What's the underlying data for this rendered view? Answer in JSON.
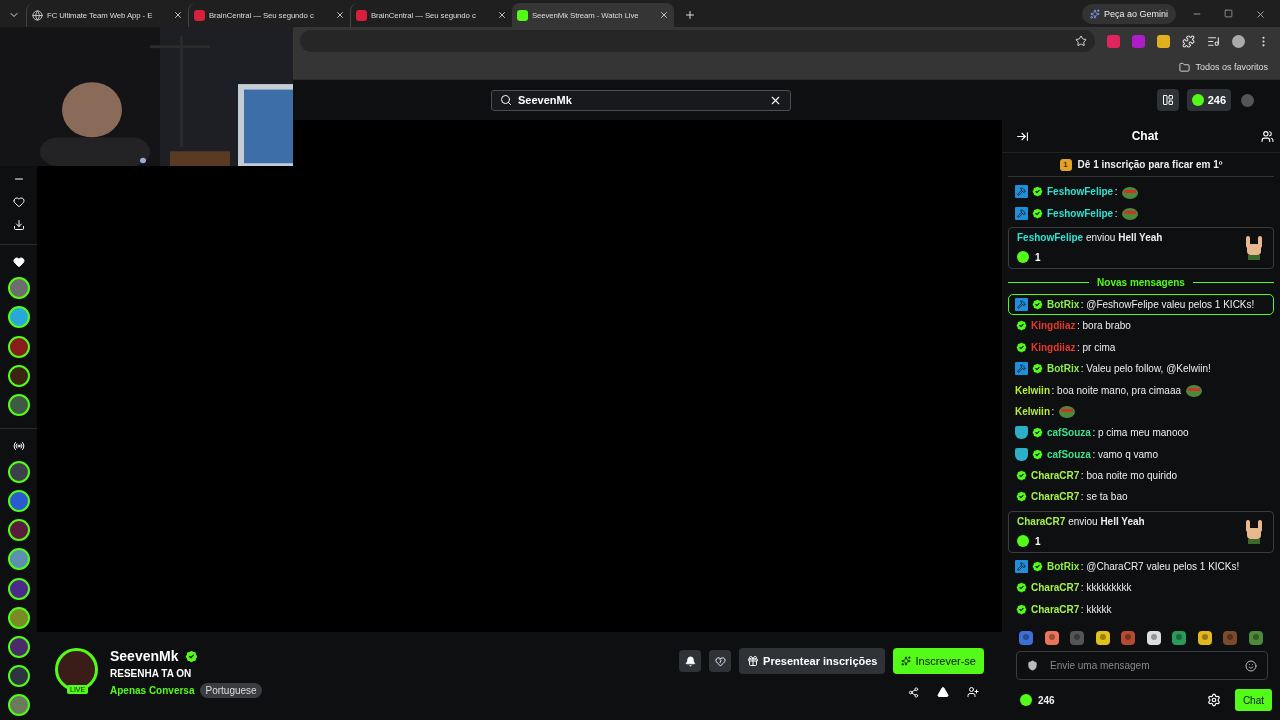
{
  "browser": {
    "tabs": [
      {
        "title": "FC Ultimate Team Web App - E",
        "kind": "globe",
        "selected": false
      },
      {
        "title": "BrainCentral — Seu segundo c",
        "kind": "brain",
        "selected": false
      },
      {
        "title": "BrainCentral — Seu segundo c",
        "kind": "brain",
        "selected": false
      },
      {
        "title": "SeevenMk Stream - Watch Live",
        "kind": "kick",
        "selected": true
      }
    ],
    "gemini_button": "Peça ao Gemini",
    "bookmarks_folder": "Todos os favoritos"
  },
  "top_bar": {
    "search": {
      "value": "SeevenMk"
    },
    "points": "246"
  },
  "sidebar": {
    "followed": [
      {
        "kind": "avatar"
      },
      {
        "kind": "avatar"
      },
      {
        "kind": "avatar"
      },
      {
        "kind": "avatar"
      },
      {
        "kind": "avatar"
      }
    ],
    "recommended": [
      {
        "kind": "avatar"
      },
      {
        "kind": "avatar"
      },
      {
        "kind": "avatar"
      },
      {
        "kind": "avatar"
      },
      {
        "kind": "avatar"
      },
      {
        "kind": "avatar"
      },
      {
        "kind": "avatar"
      },
      {
        "kind": "avatar"
      },
      {
        "kind": "avatar"
      }
    ]
  },
  "channel": {
    "name": "SeevenMk",
    "live_badge": "LIVE",
    "title": "RESENHA TA ON",
    "category": "Apenas Conversa",
    "language": "Portuguese",
    "gift_button": "Presentear inscrições",
    "subscribe_button": "Inscrever-se"
  },
  "chat": {
    "title": "Chat",
    "pinned": {
      "rank": "1",
      "text": "Dê 1 inscrição para ficar em 1º"
    },
    "messages": [
      {
        "kind": "message",
        "badges": [
          {
            "kind": "mod"
          },
          {
            "kind": "verified"
          }
        ],
        "user": "FeshowFelipe",
        "color": "#2fe3d3",
        "text": ":",
        "emote": true,
        "highlighted": false
      },
      {
        "kind": "message",
        "badges": [
          {
            "kind": "mod"
          },
          {
            "kind": "verified"
          }
        ],
        "user": "FeshowFelipe",
        "color": "#2fe3d3",
        "text": ":",
        "emote": true,
        "highlighted": false
      },
      {
        "kind": "gift",
        "user": "FeshowFelipe",
        "color": "#2fe3d3",
        "action": "enviou",
        "item": "Hell Yeah",
        "amount": "1"
      },
      {
        "kind": "divider",
        "text": "Novas mensagens"
      },
      {
        "kind": "message",
        "badges": [
          {
            "kind": "mod"
          },
          {
            "kind": "verified"
          }
        ],
        "user": "BotRix",
        "color": "#8ef04a",
        "text": ": @FeshowFelipe valeu pelos 1 KICKs!",
        "emote": false,
        "highlighted": true
      },
      {
        "kind": "message",
        "badges": [
          {
            "kind": "verified"
          }
        ],
        "user": "Kingdiiaz",
        "color": "#e5392b",
        "text": ": bora brabo",
        "emote": false,
        "highlighted": false
      },
      {
        "kind": "message",
        "badges": [
          {
            "kind": "verified"
          }
        ],
        "user": "Kingdiiaz",
        "color": "#e5392b",
        "text": ": pr cima",
        "emote": false,
        "highlighted": false
      },
      {
        "kind": "message",
        "badges": [
          {
            "kind": "mod"
          },
          {
            "kind": "verified"
          }
        ],
        "user": "BotRix",
        "color": "#8ef04a",
        "text": ": Valeu pelo follow, @Kelwiin!",
        "emote": false,
        "highlighted": false
      },
      {
        "kind": "message",
        "user": "Kelwiin",
        "color": "#b8f03a",
        "text": ": boa noite mano, pra cimaaa",
        "emote": true,
        "highlighted": false
      },
      {
        "kind": "message",
        "user": "Kelwiin",
        "color": "#b8f03a",
        "text": ":",
        "emote": true,
        "highlighted": false
      },
      {
        "kind": "message",
        "badges": [
          {
            "kind": "sub"
          },
          {
            "kind": "verified"
          }
        ],
        "user": "cafSouza",
        "color": "#3ee08a",
        "text": ": p cima meu manooo",
        "emote": false,
        "highlighted": false
      },
      {
        "kind": "message",
        "badges": [
          {
            "kind": "sub"
          },
          {
            "kind": "verified"
          }
        ],
        "user": "cafSouza",
        "color": "#3ee08a",
        "text": ": vamo q vamo",
        "emote": false,
        "highlighted": false
      },
      {
        "kind": "message",
        "badges": [
          {
            "kind": "verified"
          }
        ],
        "user": "CharaCR7",
        "color": "#a6f04a",
        "text": ": boa noite mo quirido",
        "emote": false,
        "highlighted": false
      },
      {
        "kind": "message",
        "badges": [
          {
            "kind": "verified"
          }
        ],
        "user": "CharaCR7",
        "color": "#a6f04a",
        "text": ": se ta bao",
        "emote": false,
        "highlighted": false
      },
      {
        "kind": "gift",
        "user": "CharaCR7",
        "color": "#a6f04a",
        "action": "enviou",
        "item": "Hell Yeah",
        "amount": "1"
      },
      {
        "kind": "message",
        "badges": [
          {
            "kind": "mod"
          },
          {
            "kind": "verified"
          }
        ],
        "user": "BotRix",
        "color": "#8ef04a",
        "text": ": @CharaCR7 valeu pelos 1 KICKs!",
        "emote": false,
        "highlighted": false
      },
      {
        "kind": "message",
        "badges": [
          {
            "kind": "verified"
          }
        ],
        "user": "CharaCR7",
        "color": "#a6f04a",
        "text": ": kkkkkkkkk",
        "emote": false,
        "highlighted": false
      },
      {
        "kind": "message",
        "badges": [
          {
            "kind": "verified"
          }
        ],
        "user": "CharaCR7",
        "color": "#a6f04a",
        "text": ": kkkkk",
        "emote": false,
        "highlighted": false
      }
    ],
    "emote_bar": [
      {
        "kind": "emote"
      },
      {
        "kind": "emote"
      },
      {
        "kind": "emote"
      },
      {
        "kind": "emote"
      },
      {
        "kind": "emote"
      },
      {
        "kind": "emote"
      },
      {
        "kind": "emote"
      },
      {
        "kind": "emote"
      },
      {
        "kind": "emote"
      },
      {
        "kind": "emote"
      }
    ],
    "input": {
      "placeholder": "Envie uma mensagem"
    },
    "points": "246",
    "send_button": "Chat"
  }
}
